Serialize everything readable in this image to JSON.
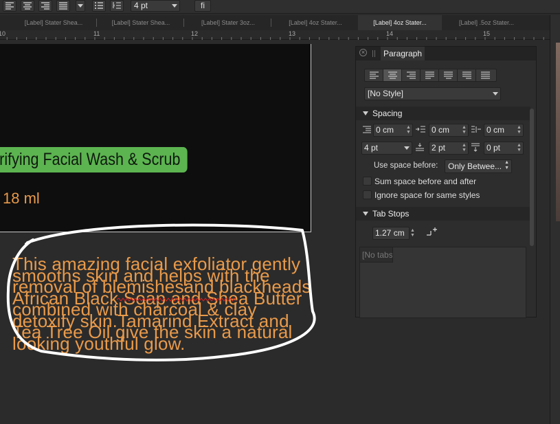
{
  "toolbar": {
    "stroke_size": "4 pt",
    "ligature_glyph": "fi"
  },
  "tabs": [
    "[Label] Stater Shea...",
    "[Label] Stater Shea...",
    "[Label] Stater 3oz...",
    "[Label] 4oz Stater...",
    "[Label] 4oz Stater...",
    "[Label] .5oz Stater..."
  ],
  "ruler": [
    "10",
    "11",
    "12",
    "13",
    "14",
    "15"
  ],
  "document": {
    "product_name": "rifying Facial Wash & Scrub",
    "size": "18 ml",
    "description_lines": [
      "This amazing facial exfoliator gently",
      "smooths skin and helps with the",
      "removal of blemishesand blackheads",
      "African Black Soap and Shea Butter",
      "combined with charcoal & clay",
      "detoxify skin.Tamarind Extract and",
      "Tea Tree Oil give the skin a natural",
      "looking youthful glow."
    ],
    "text_color": "#e99a4a",
    "banner_color": "#5cb450"
  },
  "panel": {
    "title": "Paragraph",
    "style_select": "[No Style]",
    "spacing": {
      "heading": "Spacing",
      "left_indent": "0 cm",
      "first_line_indent": "0 cm",
      "right_indent": "0 cm",
      "leading": "4 pt",
      "space_before": "2 pt",
      "space_after": "0 pt",
      "use_space_before_label": "Use space before:",
      "use_space_before_value": "Only Betwee...",
      "sum_space_label": "Sum space before and after",
      "ignore_space_label": "Ignore space for same styles"
    },
    "tab_stops": {
      "heading": "Tab Stops",
      "default_tab": "1.27 cm",
      "tabs_placeholder": "[No tabs"
    }
  }
}
